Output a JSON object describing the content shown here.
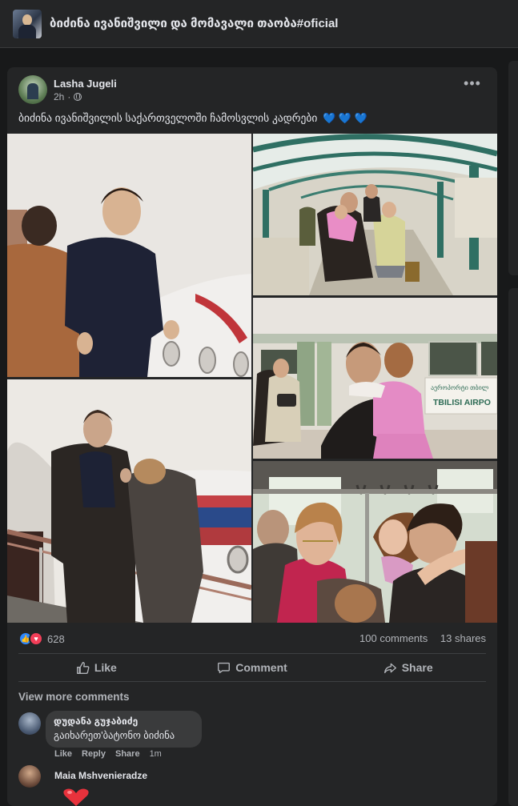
{
  "group": {
    "title": "ბიძინა ივანიშვილი და მომავალი თაობა#oficial"
  },
  "post": {
    "author": "Lasha Jugeli",
    "time": "2h",
    "separator": "·",
    "more_icon": "more-horizontal-icon",
    "text": "ბიძინა ივანიშვილის საქართველოში ჩამოსვლის კადრები",
    "hearts": "💙 💙 💙",
    "photos": [
      {
        "alt": "Man in dark sweater descending airplane steps"
      },
      {
        "alt": "Family walking through covered airport walkway"
      },
      {
        "alt": "Man carrying girl in pink dress near TBILISI AIRPORT bus"
      },
      {
        "alt": "Man in dark coat on airplane stairs"
      },
      {
        "alt": "Man hugging child inside crowded bus"
      }
    ],
    "sign_text_1": "TBILISI AIRPO",
    "sign_text_2": "აეროპორტი თბილ"
  },
  "stats": {
    "reaction_count": "628",
    "comments": "100 comments",
    "shares": "13 shares"
  },
  "actions": {
    "like": "Like",
    "comment": "Comment",
    "share": "Share"
  },
  "comments": {
    "view_more": "View more comments",
    "items": [
      {
        "name": "დუდანა გუჯაბიძე",
        "text": "გაიხარეთ'ბატონო ბიძინა",
        "like": "Like",
        "reply": "Reply",
        "share": "Share",
        "time": "1m"
      },
      {
        "name": "Maia Mshvenieradze"
      }
    ]
  },
  "colors": {
    "background": "#18191a",
    "card": "#242526",
    "text_primary": "#e4e6eb",
    "text_secondary": "#b0b3b8",
    "like_blue": "#2d88ff",
    "love_red": "#f33e58"
  }
}
